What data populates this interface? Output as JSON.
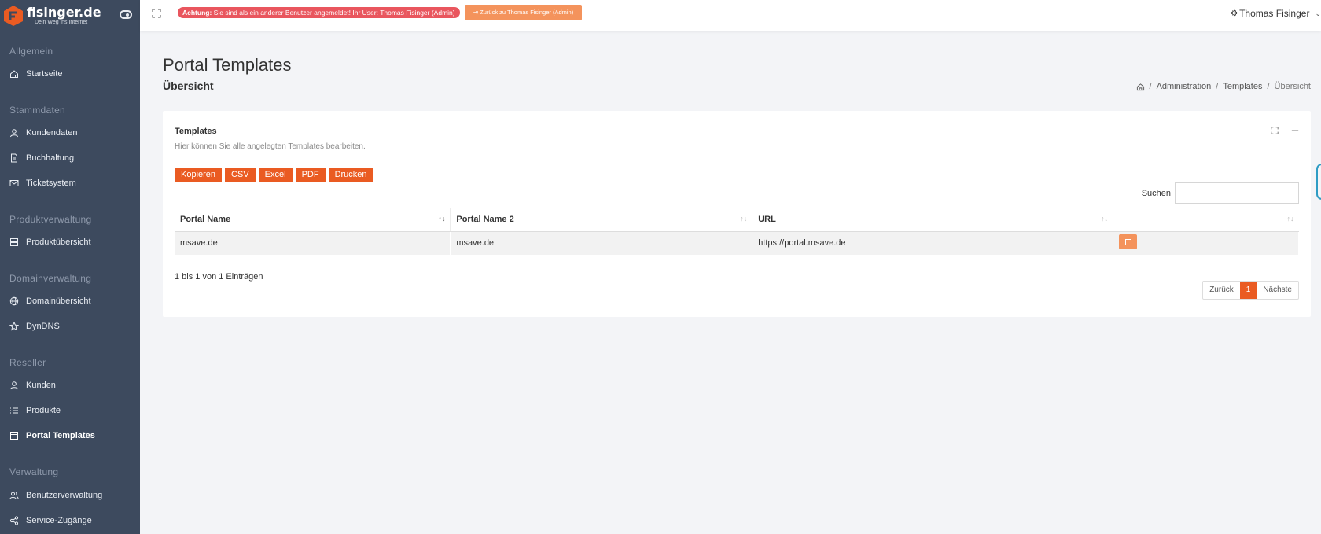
{
  "brand": {
    "name": "fisinger.de",
    "tagline": "Dein Weg ins Internet",
    "accent": "#ea5b22"
  },
  "sidebar": {
    "sections": [
      {
        "title": "Allgemein",
        "items": [
          {
            "label": "Startseite",
            "icon": "home-icon"
          }
        ]
      },
      {
        "title": "Stammdaten",
        "items": [
          {
            "label": "Kundendaten",
            "icon": "user-icon"
          },
          {
            "label": "Buchhaltung",
            "icon": "document-icon"
          },
          {
            "label": "Ticketsystem",
            "icon": "mail-icon"
          }
        ]
      },
      {
        "title": "Produktverwaltung",
        "items": [
          {
            "label": "Produktübersicht",
            "icon": "server-icon"
          }
        ]
      },
      {
        "title": "Domainverwaltung",
        "items": [
          {
            "label": "Domainübersicht",
            "icon": "globe-icon"
          },
          {
            "label": "DynDNS",
            "icon": "star-icon"
          }
        ]
      },
      {
        "title": "Reseller",
        "items": [
          {
            "label": "Kunden",
            "icon": "user-icon"
          },
          {
            "label": "Produkte",
            "icon": "list-icon"
          },
          {
            "label": "Portal Templates",
            "icon": "layout-icon",
            "active": true
          }
        ]
      },
      {
        "title": "Verwaltung",
        "items": [
          {
            "label": "Benutzerverwaltung",
            "icon": "users-icon"
          },
          {
            "label": "Service-Zugänge",
            "icon": "share-icon"
          }
        ]
      }
    ]
  },
  "topbar": {
    "alert_strong": "Achtung:",
    "alert_text": "Sie sind als ein anderer Benutzer angemeldet! Ihr User: Thomas Fisinger (Admin)",
    "back_button": "Zurück zu Thomas Fisinger (Admin)",
    "user_name": "Thomas Fisinger"
  },
  "page": {
    "title": "Portal Templates",
    "subtitle": "Übersicht",
    "breadcrumb": [
      "Administration",
      "Templates",
      "Übersicht"
    ]
  },
  "card": {
    "title": "Templates",
    "description": "Hier können Sie alle angelegten Templates bearbeiten.",
    "buttons": [
      "Kopieren",
      "CSV",
      "Excel",
      "PDF",
      "Drucken"
    ],
    "search_label": "Suchen",
    "search_value": "",
    "columns": [
      "Portal Name",
      "Portal Name 2",
      "URL",
      ""
    ],
    "rows": [
      [
        "msave.de",
        "msave.de",
        "https://portal.msave.de"
      ]
    ],
    "info": "1 bis 1 von 1 Einträgen",
    "pager": {
      "prev": "Zurück",
      "current": "1",
      "next": "Nächste"
    }
  }
}
